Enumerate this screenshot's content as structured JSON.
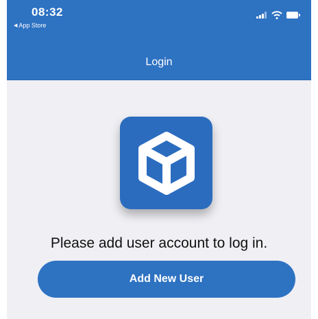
{
  "status_bar": {
    "time": "08:32",
    "back_app_label": "App Store",
    "icons": [
      "signal-icon",
      "wifi-icon",
      "battery-icon"
    ]
  },
  "nav": {
    "title": "Login"
  },
  "main": {
    "logo_icon": "cube-icon",
    "prompt": "Please add user account to log in.",
    "add_user_label": "Add New User"
  },
  "colors": {
    "accent": "#2e72c2",
    "background": "#efeff4",
    "text": "#111111"
  }
}
